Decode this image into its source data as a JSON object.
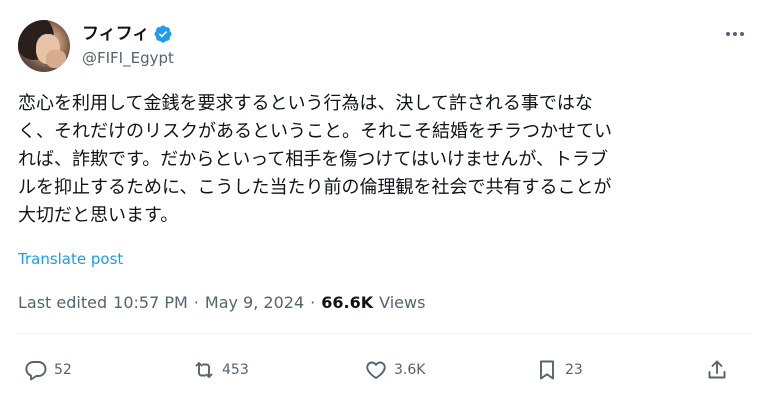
{
  "user": {
    "display_name": "フィフィ",
    "handle": "@FIFI_Egypt",
    "verified": true,
    "verified_color": "#1d9bf0"
  },
  "tweet": {
    "lines": [
      "恋心を利用して金銭を要求するという行為は、決して許される事ではな",
      "く、それだけのリスクがあるということ。それこそ結婚をチラつかせてい",
      "れば、詐欺です。だからといって相手を傷つけてはいけませんが、トラブ",
      "ルを抑止するために、こうした当たり前の倫理観を社会で共有することが",
      "大切だと思います。"
    ],
    "translate_label": "Translate post"
  },
  "meta": {
    "edited_label": "Last edited",
    "time": "10:57 PM",
    "separator1": "·",
    "date": "May 9, 2024",
    "separator2": "·",
    "views_count": "66.6K",
    "views_label": "Views"
  },
  "actions": {
    "replies": "52",
    "reposts": "453",
    "likes": "3.6K",
    "bookmarks": "23"
  },
  "icons": {
    "more": "more-icon",
    "reply": "reply-icon",
    "repost": "repost-icon",
    "like": "heart-icon",
    "bookmark": "bookmark-icon",
    "share": "share-icon",
    "verified": "verified-badge-icon"
  }
}
